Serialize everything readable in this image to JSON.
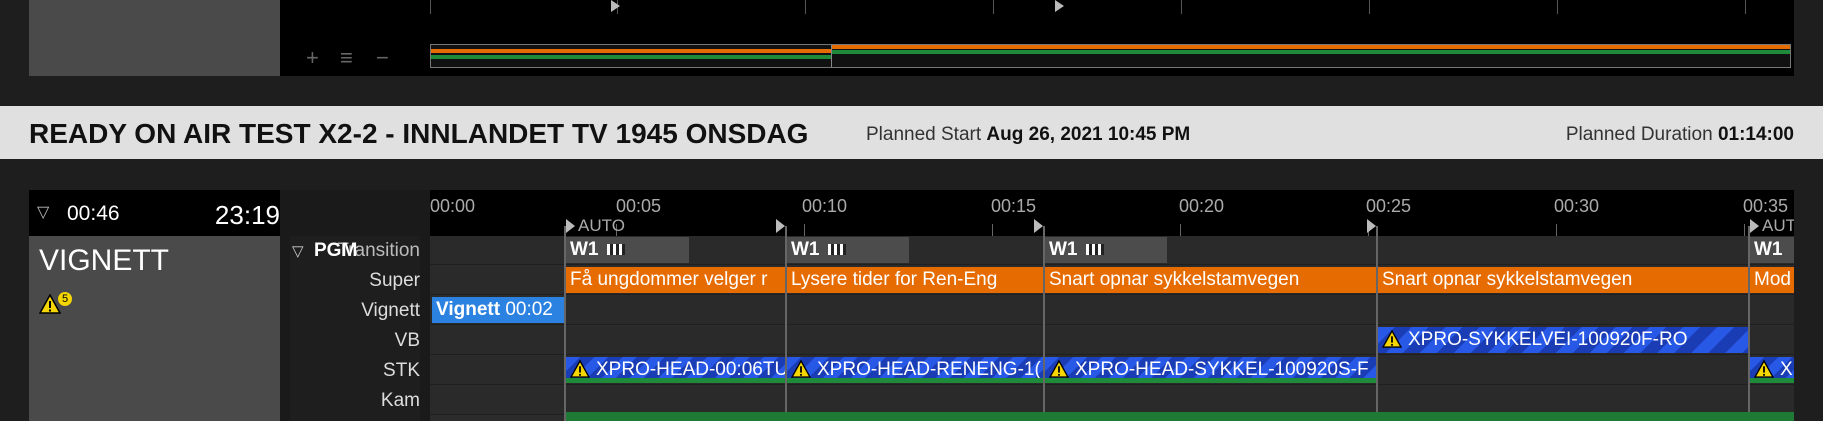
{
  "top_segment": {
    "tool_add": "+",
    "tool_fit": "≡",
    "tool_remove": "−"
  },
  "header": {
    "title": "READY ON AIR TEST X2-2 - INNLANDET TV 1945 ONSDAG",
    "planned_start_label": "Planned Start",
    "planned_start_value": "Aug 26, 2021 10:45 PM",
    "planned_duration_label": "Planned Duration",
    "planned_duration_value": "01:14:00"
  },
  "segment": {
    "duration": "00:46",
    "time": "23:19",
    "name": "VIGNETT",
    "warning_count": "5"
  },
  "layers": {
    "pgm": "PGM",
    "transition": "Transition",
    "super": "Super",
    "vignett": "Vignett",
    "vb": "VB",
    "stk": "STK",
    "kam": "Kam"
  },
  "ruler": [
    "00:00",
    "00:05",
    "00:10",
    "00:15",
    "00:20",
    "00:25",
    "00:30",
    "00:35"
  ],
  "auto_labels": [
    "AUTO",
    "AUTO"
  ],
  "pieces": {
    "w1": "W1",
    "super_1": "Få ungdommer velger r",
    "super_2": "Lysere tider for Ren-Eng",
    "super_3": "Snart opnar sykkelstamvegen",
    "super_4": "Snart opnar sykkelstamvegen",
    "super_5": "Mod",
    "vignett": "Vignett",
    "vignett_time": "00:02",
    "vb_1": "XPRO-SYKKELVEI-100920F-RO",
    "stk_1": "XPRO-HEAD-00:06TU",
    "stk_2": "XPRO-HEAD-RENENG-1(",
    "stk_3": "XPRO-HEAD-SYKKEL-100920S-F",
    "stk_4": "X"
  },
  "colors": {
    "super": "#e66b00",
    "vignett": "#2c82e0",
    "video_stripe": "#2758e6",
    "kam": "#1e7a35",
    "warning": "#f5d600"
  }
}
